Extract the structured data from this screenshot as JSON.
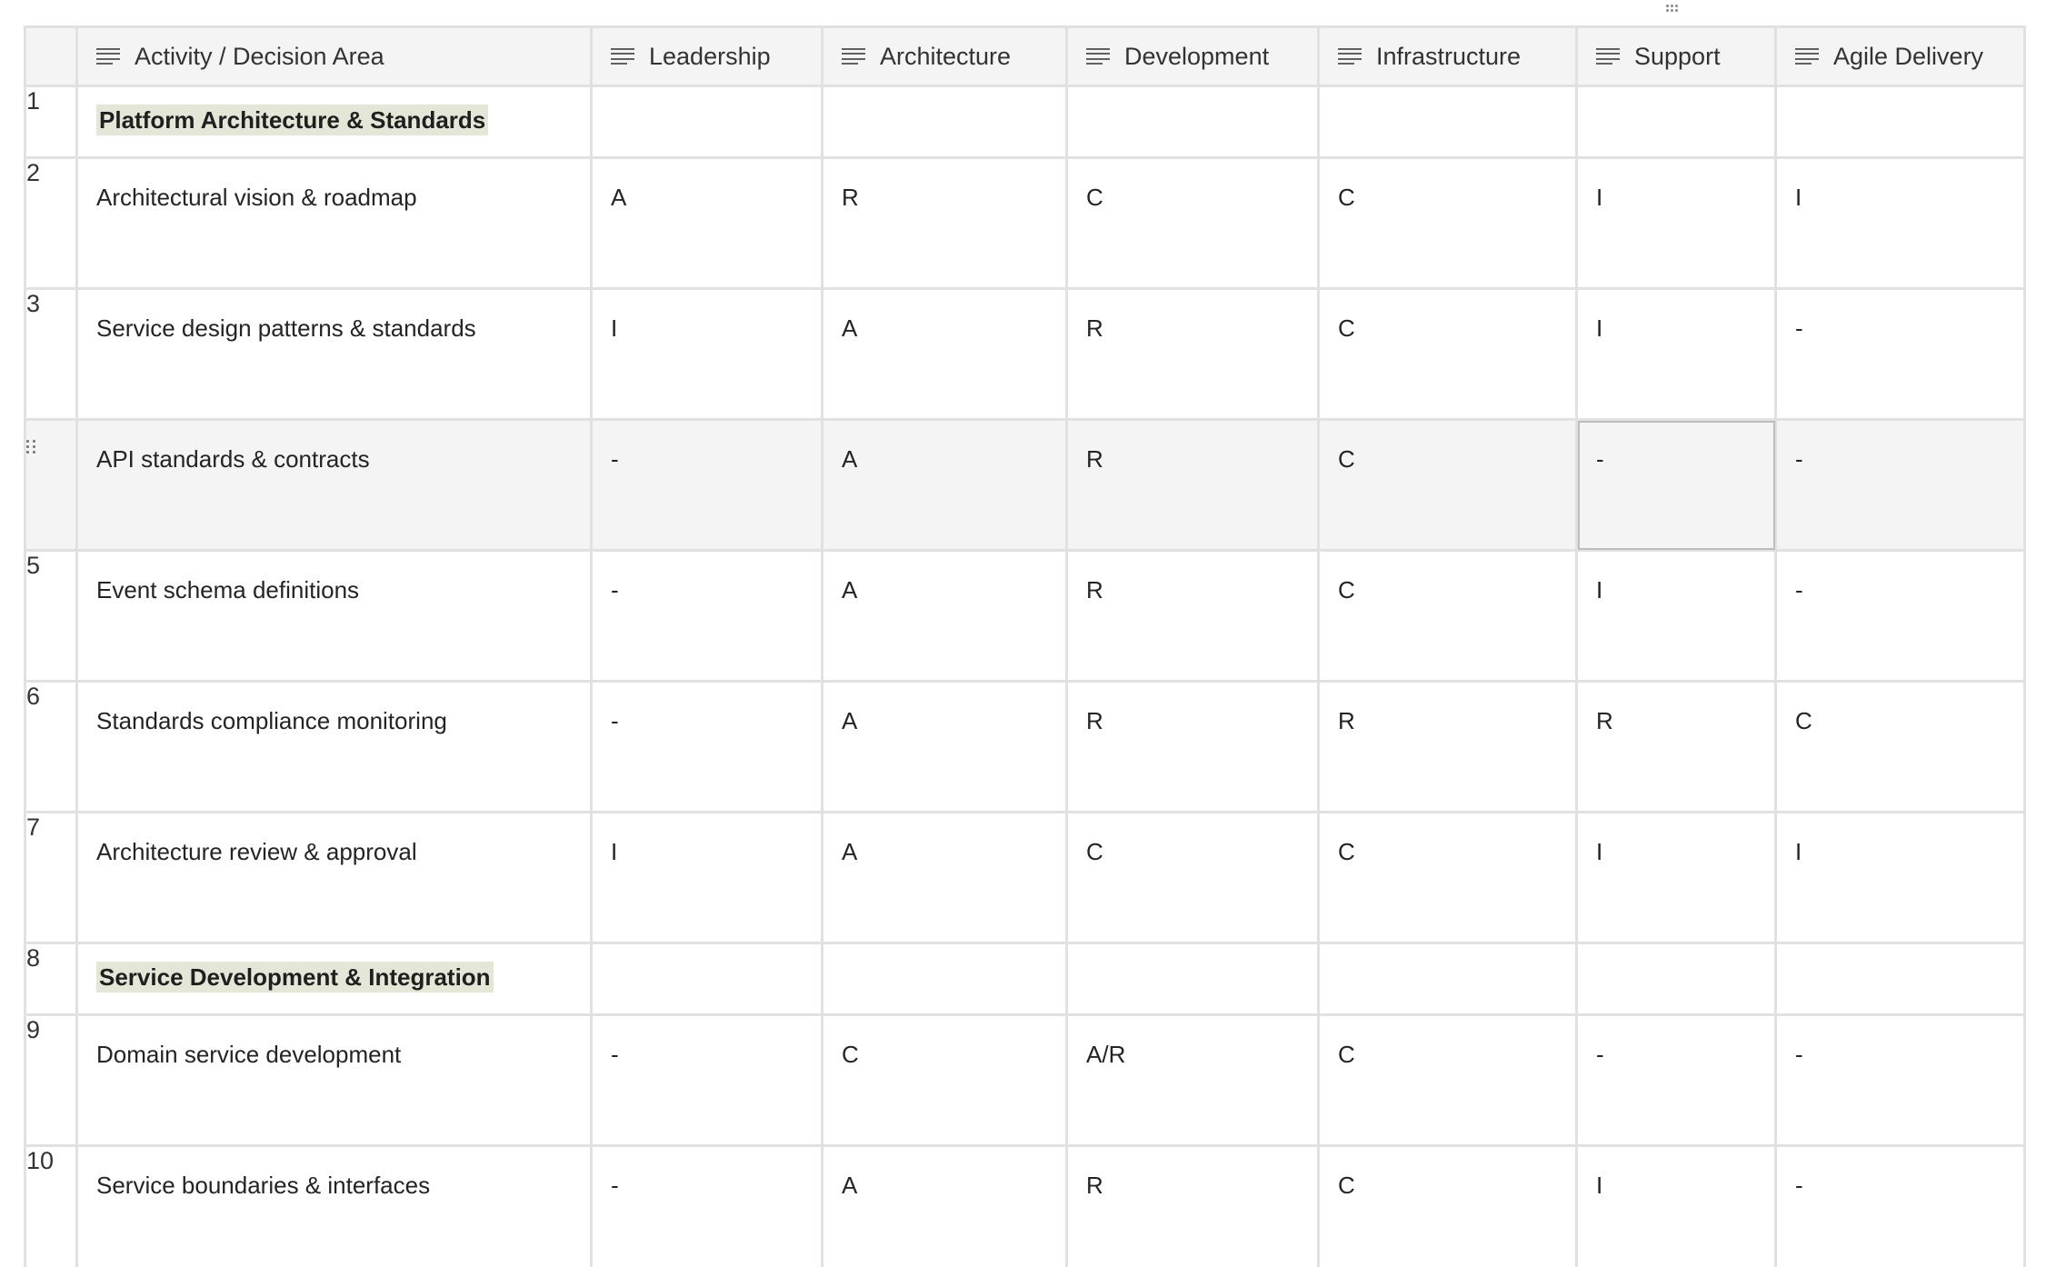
{
  "table": {
    "columns": [
      {
        "label": "Activity / Decision Area"
      },
      {
        "label": "Leadership"
      },
      {
        "label": "Architecture"
      },
      {
        "label": "Development"
      },
      {
        "label": "Infrastructure"
      },
      {
        "label": "Support"
      },
      {
        "label": "Agile Delivery"
      }
    ],
    "rows": [
      {
        "num": "1",
        "activity": "Platform Architecture & Standards"
      },
      {
        "num": "2",
        "activity": "Architectural vision & roadmap",
        "cells": [
          "A",
          "R",
          "C",
          "C",
          "I",
          "I"
        ]
      },
      {
        "num": "3",
        "activity": "Service design patterns & standards",
        "cells": [
          "I",
          "A",
          "R",
          "C",
          "I",
          "-"
        ]
      },
      {
        "num": "",
        "activity": "API standards & contracts",
        "cells": [
          "-",
          "A",
          "R",
          "C",
          "-",
          "-"
        ]
      },
      {
        "num": "5",
        "activity": "Event schema definitions",
        "cells": [
          "-",
          "A",
          "R",
          "C",
          "I",
          "-"
        ]
      },
      {
        "num": "6",
        "activity": "Standards compliance monitoring",
        "cells": [
          "-",
          "A",
          "R",
          "R",
          "R",
          "C"
        ]
      },
      {
        "num": "7",
        "activity": "Architecture review & approval",
        "cells": [
          "I",
          "A",
          "C",
          "C",
          "I",
          "I"
        ]
      },
      {
        "num": "8",
        "activity": "Service Development & Integration"
      },
      {
        "num": "9",
        "activity": "Domain service development",
        "cells": [
          "-",
          "C",
          "A/R",
          "C",
          "-",
          "-"
        ]
      },
      {
        "num": "10",
        "activity": "Service boundaries & interfaces",
        "cells": [
          "-",
          "A",
          "R",
          "C",
          "I",
          "-"
        ]
      }
    ]
  }
}
